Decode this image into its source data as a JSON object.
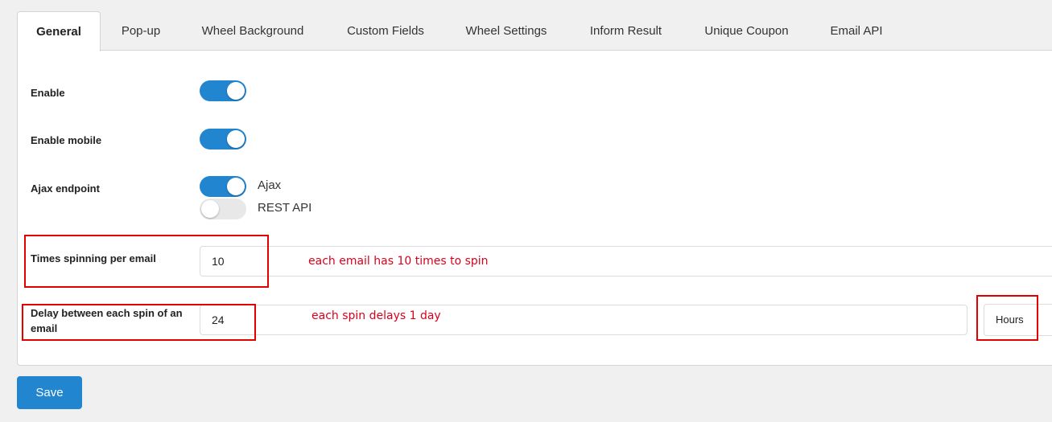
{
  "tabs": [
    {
      "label": "General",
      "active": true
    },
    {
      "label": "Pop-up"
    },
    {
      "label": "Wheel Background"
    },
    {
      "label": "Custom Fields"
    },
    {
      "label": "Wheel Settings"
    },
    {
      "label": "Inform Result"
    },
    {
      "label": "Unique Coupon"
    },
    {
      "label": "Email API"
    }
  ],
  "fields": {
    "enable": {
      "label": "Enable",
      "on": true
    },
    "enable_mobile": {
      "label": "Enable mobile",
      "on": true
    },
    "ajax_endpoint": {
      "label": "Ajax endpoint",
      "options": [
        {
          "label": "Ajax",
          "on": true
        },
        {
          "label": "REST API",
          "on": false
        }
      ]
    },
    "times_spinning": {
      "label": "Times spinning per email",
      "value": "10",
      "note": "each email has 10 times to spin"
    },
    "delay": {
      "label": "Delay between each spin of an email",
      "value": "24",
      "note": "each spin delays 1 day",
      "unit": "Hours"
    }
  },
  "save_label": "Save",
  "colors": {
    "accent": "#2185d0",
    "annotation": "#e50000"
  }
}
